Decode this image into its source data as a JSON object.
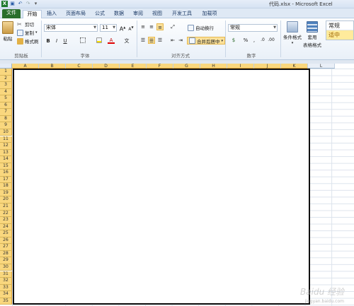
{
  "window": {
    "title": "代码.xlsx - Microsoft Excel"
  },
  "quick_access": {
    "icons": [
      "excel-logo-icon",
      "save-icon",
      "undo-icon",
      "redo-icon",
      "customize-icon"
    ]
  },
  "tabs": [
    {
      "label": "文件"
    },
    {
      "label": "开始"
    },
    {
      "label": "插入"
    },
    {
      "label": "页面布局"
    },
    {
      "label": "公式"
    },
    {
      "label": "数据"
    },
    {
      "label": "审阅"
    },
    {
      "label": "视图"
    },
    {
      "label": "开发工具"
    },
    {
      "label": "加载项"
    }
  ],
  "ribbon": {
    "clipboard": {
      "paste_label": "粘贴",
      "cut_label": "剪切",
      "copy_label": "复制",
      "format_painter_label": "格式刷",
      "group_label": "剪贴板"
    },
    "font": {
      "font_name": "宋体",
      "font_size": "11",
      "grow_label": "A",
      "shrink_label": "A",
      "bold_label": "B",
      "italic_label": "I",
      "underline_label": "U",
      "font_color_label": "A",
      "phonetic_label": "文",
      "group_label": "字体"
    },
    "alignment": {
      "wrap_text_label": "自动换行",
      "merge_center_label": "合并后居中",
      "group_label": "对齐方式"
    },
    "number": {
      "format_value": "常规",
      "percent_label": "%",
      "comma_label": ",",
      "group_label": "数字"
    },
    "styles": {
      "conditional_label": "条件格式",
      "table_label_line1": "套用",
      "table_label_line2": "表格格式",
      "style_normal": "常规",
      "style_neutral": "适中"
    }
  },
  "grid": {
    "columns": [
      "A",
      "B",
      "C",
      "D",
      "E",
      "F",
      "G",
      "H",
      "I",
      "J",
      "K",
      "L"
    ],
    "rows": [
      "1",
      "2",
      "3",
      "4",
      "5",
      "6",
      "7",
      "8",
      "9",
      "10",
      "11",
      "12",
      "13",
      "14",
      "15",
      "16",
      "17",
      "18",
      "19",
      "20",
      "21",
      "22",
      "23",
      "24",
      "25",
      "26",
      "27",
      "28",
      "29",
      "30",
      "31",
      "32",
      "33",
      "34",
      "35"
    ]
  },
  "watermark": {
    "text": "Baidu 经验",
    "sub": "jingyan.baidu.com"
  },
  "colors": {
    "file_tab": "#2a6f2b",
    "selection_header": "#f9d77e",
    "selection_border": "#111111"
  }
}
